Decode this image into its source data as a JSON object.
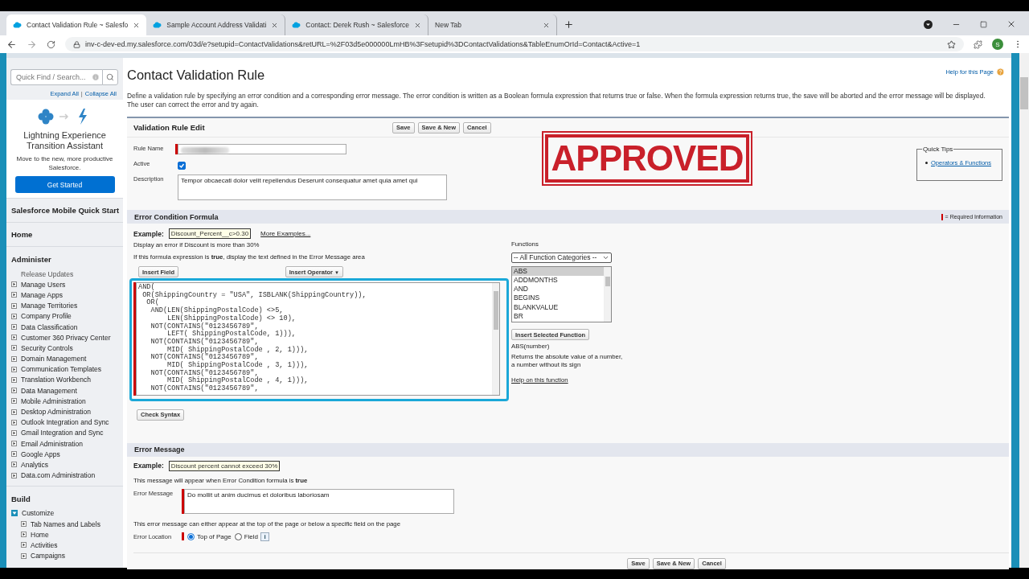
{
  "browser": {
    "tabs": [
      {
        "title": "Contact Validation Rule ~ Salesfo",
        "selected": true
      },
      {
        "title": "Sample Account Address Validati",
        "selected": false
      },
      {
        "title": "Contact: Derek Rush ~ Salesforce",
        "selected": false
      },
      {
        "title": "New Tab",
        "selected": false
      }
    ],
    "url": "inv-c-dev-ed.my.salesforce.com/03d/e?setupid=ContactValidations&retURL=%2F03d5e000000LmHB%3Fsetupid%3DContactValidations&TableEnumOrId=Contact&Active=1",
    "profile": "S"
  },
  "sidebar": {
    "search": {
      "placeholder": "Quick Find / Search..."
    },
    "expand_all": "Expand All",
    "separator": "|",
    "collapse_all": "Collapse All",
    "promo": {
      "title": "Lightning Experience Transition Assistant",
      "text": "Move to the new, more productive Salesforce.",
      "button": "Get Started"
    },
    "sections": [
      {
        "title": "Salesforce Mobile Quick Start"
      },
      {
        "title": "Home"
      },
      {
        "title": "Administer",
        "items": [
          {
            "label": "Release Updates",
            "kind": "link"
          },
          {
            "label": "Manage Users",
            "kind": "folder",
            "expanded": false
          },
          {
            "label": "Manage Apps",
            "kind": "folder",
            "expanded": false
          },
          {
            "label": "Manage Territories",
            "kind": "folder",
            "expanded": false
          },
          {
            "label": "Company Profile",
            "kind": "folder",
            "expanded": false
          },
          {
            "label": "Data Classification",
            "kind": "folder",
            "expanded": false
          },
          {
            "label": "Customer 360 Privacy Center",
            "kind": "folder",
            "expanded": false
          },
          {
            "label": "Security Controls",
            "kind": "folder",
            "expanded": false
          },
          {
            "label": "Domain Management",
            "kind": "folder",
            "expanded": false
          },
          {
            "label": "Communication Templates",
            "kind": "folder",
            "expanded": false
          },
          {
            "label": "Translation Workbench",
            "kind": "folder",
            "expanded": false
          },
          {
            "label": "Data Management",
            "kind": "folder",
            "expanded": false
          },
          {
            "label": "Mobile Administration",
            "kind": "folder",
            "expanded": false
          },
          {
            "label": "Desktop Administration",
            "kind": "folder",
            "expanded": false
          },
          {
            "label": "Outlook Integration and Sync",
            "kind": "folder",
            "expanded": false
          },
          {
            "label": "Gmail Integration and Sync",
            "kind": "folder",
            "expanded": false
          },
          {
            "label": "Email Administration",
            "kind": "folder",
            "expanded": false
          },
          {
            "label": "Google Apps",
            "kind": "folder",
            "expanded": false
          },
          {
            "label": "Analytics",
            "kind": "folder",
            "expanded": false
          },
          {
            "label": "Data.com Administration",
            "kind": "folder",
            "expanded": false
          }
        ]
      },
      {
        "title": "Build",
        "items": [
          {
            "label": "Customize",
            "kind": "folder",
            "expanded": true,
            "children": [
              {
                "label": "Tab Names and Labels",
                "kind": "folder",
                "expanded": false
              },
              {
                "label": "Home",
                "kind": "folder",
                "expanded": false
              },
              {
                "label": "Activities",
                "kind": "folder",
                "expanded": false
              },
              {
                "label": "Campaigns",
                "kind": "folder",
                "expanded": false
              }
            ]
          }
        ]
      }
    ]
  },
  "page": {
    "title": "Contact Validation Rule",
    "help": "Help for this Page",
    "description": "Define a validation rule by specifying an error condition and a corresponding error message. The error condition is written as a Boolean formula expression that returns true or false. When the formula expression returns true, the save will be aborted and the error message will be displayed. The user can correct the error and try again."
  },
  "edit": {
    "title": "Validation Rule Edit",
    "buttons": [
      "Save",
      "Save & New",
      "Cancel"
    ],
    "rule_name": {
      "label": "Rule Name"
    },
    "active": {
      "label": "Active",
      "checked": true
    },
    "description": {
      "label": "Description",
      "value": "Tempor obcaecati dolor velit repellendus Deserunt consequatur amet quia amet qui"
    },
    "stamp": "APPROVED",
    "quick_tips": {
      "title": "Quick Tips",
      "links": [
        "Operators & Functions"
      ]
    }
  },
  "formula": {
    "title": "Error Condition Formula",
    "required_legend": "= Required Information",
    "example_label": "Example:",
    "example": "Discount_Percent__c>0.30",
    "more_examples": "More Examples...",
    "example_note": "Display an error if Discount is more than 30%",
    "instruction": "If this formula expression is **true**, display the text defined in the Error Message area",
    "insert_field": "Insert Field",
    "insert_operator": "Insert Operator",
    "operator_caret": "▼",
    "lines": [
      "AND(",
      " OR(ShippingCountry = \"USA\", ISBLANK(ShippingCountry)),",
      "  OR(",
      "   AND(LEN(ShippingPostalCode) <>5,",
      "       LEN(ShippingPostalCode) <> 10),",
      "   NOT(CONTAINS(\"0123456789\",",
      "       LEFT( ShippingPostalCode, 1))),",
      "   NOT(CONTAINS(\"0123456789\",",
      "       MID( ShippingPostalCode , 2, 1))),",
      "   NOT(CONTAINS(\"0123456789\",",
      "       MID( ShippingPostalCode , 3, 1))),",
      "   NOT(CONTAINS(\"0123456789\",",
      "       MID( ShippingPostalCode , 4, 1))),",
      "   NOT(CONTAINS(\"0123456789\","
    ],
    "check_syntax": "Check Syntax",
    "functions": {
      "label": "Functions",
      "category": "-- All Function Categories --",
      "items": [
        {
          "name": "ABS",
          "selected": true
        },
        {
          "name": "ADDMONTHS",
          "selected": false
        },
        {
          "name": "AND",
          "selected": false
        },
        {
          "name": "BEGINS",
          "selected": false
        },
        {
          "name": "BLANKVALUE",
          "selected": false
        },
        {
          "name": "BR",
          "selected": false
        }
      ],
      "insert": "Insert Selected Function",
      "signature": "ABS(number)",
      "help_text": "Returns the absolute value of a number, a number without its sign",
      "help_link": "Help on this function"
    }
  },
  "error_message": {
    "title": "Error Message",
    "example_label": "Example:",
    "example": "Discount percent cannot exceed 30%",
    "note": "This message will appear when Error Condition formula is **true**",
    "label": "Error Message",
    "value": "Do mollit ut anim ducimus et doloribus laboriosam",
    "location_note": "This error message can either appear at the top of the page or below a specific field on the page",
    "location_label": "Error Location",
    "options": [
      {
        "label": "Top of Page",
        "selected": true
      },
      {
        "label": "Field",
        "selected": false
      }
    ],
    "info": "i",
    "buttons": [
      "Save",
      "Save & New",
      "Cancel"
    ]
  }
}
